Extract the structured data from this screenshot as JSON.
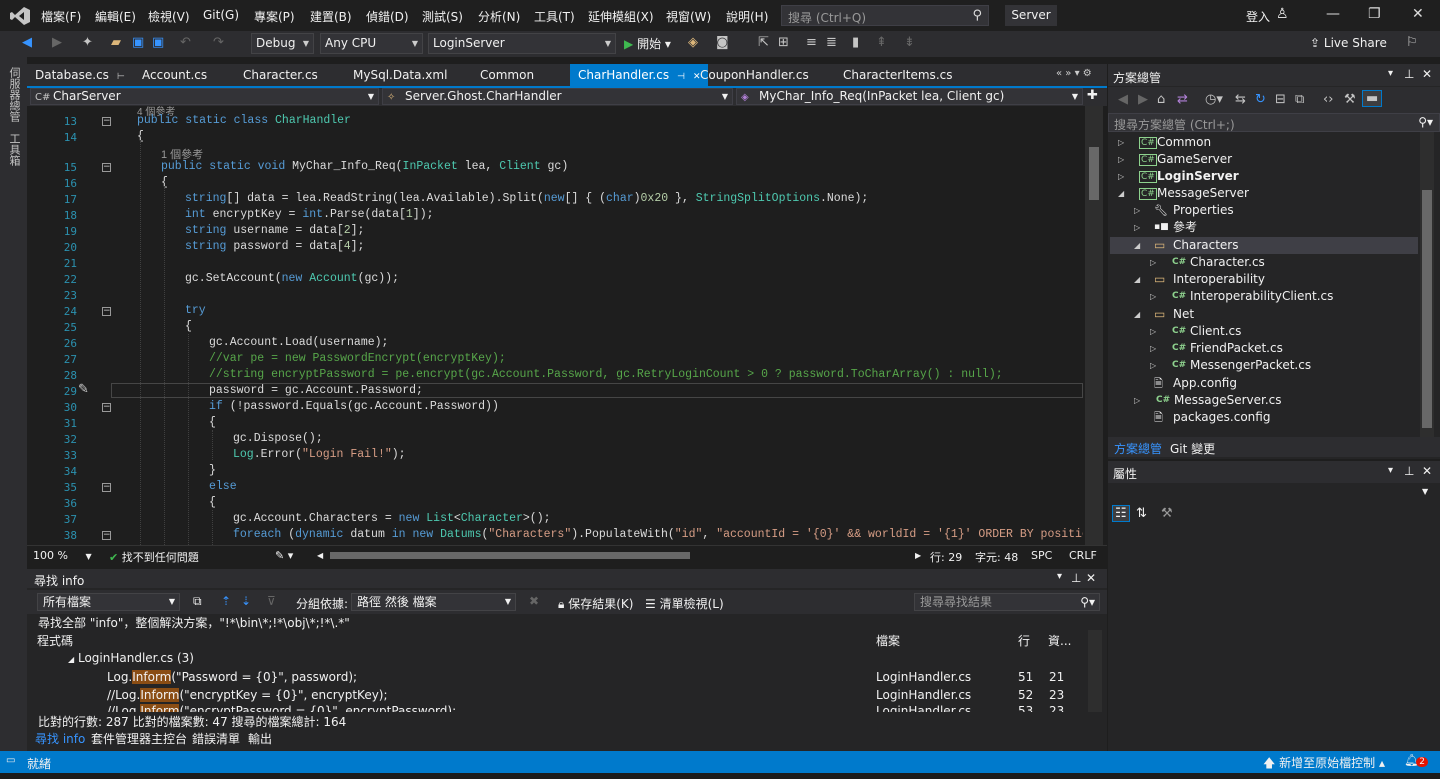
{
  "menu": [
    "檔案(F)",
    "編輯(E)",
    "檢視(V)",
    "Git(G)",
    "專案(P)",
    "建置(B)",
    "偵錯(D)",
    "測試(S)",
    "分析(N)",
    "工具(T)",
    "延伸模組(X)",
    "視窗(W)",
    "說明(H)"
  ],
  "search_placeholder": "搜尋 (Ctrl+Q)",
  "solution_name": "Server",
  "signin": "登入",
  "toolbar": {
    "config": "Debug",
    "platform": "Any CPU",
    "startup": "LoginServer",
    "start": "開始",
    "liveshare": "Live Share"
  },
  "left_tabs": [
    "伺服器總管",
    "工具箱"
  ],
  "tabs": [
    "Database.cs",
    "Account.cs",
    "Character.cs",
    "MySql.Data.xml",
    "Common",
    "CharHandler.cs",
    "CouponHandler.cs",
    "CharacterItems.cs"
  ],
  "active_tab": "CharHandler.cs",
  "nav": {
    "project": "CharServer",
    "type": "Server.Ghost.CharHandler",
    "member": "MyChar_Info_Req(InPacket lea, Client gc)"
  },
  "code": {
    "lens_top": "4 個參考",
    "line13": "public static class CharHandler",
    "line14": "{",
    "lens": "1 個參考",
    "line15": "public static void MyChar_Info_Req(InPacket lea, Client gc)",
    "line16": "{",
    "line17": "string[] data = lea.ReadString(lea.Available).Split(new[] { (char)0x20 }, StringSplitOptions.None);",
    "line18": "int encryptKey = int.Parse(data[1]);",
    "line19": "string username = data[2];",
    "line20": "string password = data[4];",
    "line21": "",
    "line22": "gc.SetAccount(new Account(gc));",
    "line23": "",
    "line24": "try",
    "line25": "{",
    "line26": "gc.Account.Load(username);",
    "line27": "//var pe = new PasswordEncrypt(encryptKey);",
    "line28": "//string encryptPassword = pe.encrypt(gc.Account.Password, gc.RetryLoginCount > 0 ? password.ToCharArray() : null);",
    "line29": "password = gc.Account.Password;",
    "line30": "if (!password.Equals(gc.Account.Password))",
    "line31": "{",
    "line32": "gc.Dispose();",
    "line33": "Log.Error(\"Login Fail!\");",
    "line34": "}",
    "line35": "else",
    "line36": "{",
    "line37": "gc.Account.Characters = new List<Character>();",
    "line38": "foreach (dynamic datum in new Datums(\"Characters\").PopulateWith(\"id\", \"accountId = '{0}' && worldId = '{1}' ORDER BY position ASC\", gc.Account"
  },
  "line_numbers": [
    "13",
    "14",
    "15",
    "16",
    "17",
    "18",
    "19",
    "20",
    "21",
    "22",
    "23",
    "24",
    "25",
    "26",
    "27",
    "28",
    "29",
    "30",
    "31",
    "32",
    "33",
    "34",
    "35",
    "36",
    "37",
    "38"
  ],
  "editor_status": {
    "zoom": "100 %",
    "issues": "找不到任何問題",
    "line": "行: 29",
    "col": "字元: 48",
    "spc": "SPC",
    "crlf": "CRLF"
  },
  "find": {
    "title": "尋找 info",
    "scope": "所有檔案",
    "group_label": "分組依據:",
    "group_value": "路徑 然後 檔案",
    "keep": "保存結果(K)",
    "list_view": "清單檢視(L)",
    "search_ph": "搜尋尋找結果",
    "summary_line": "尋找全部 \"info\"，整個解決方案，\"!*\\bin\\*;!*\\obj\\*;!*\\.*\"",
    "col_code": "程式碼",
    "col_file": "檔案",
    "col_line": "行",
    "col_col": "資...",
    "group": "LoginHandler.cs (3)",
    "results": [
      {
        "pre": "Log.",
        "hl": "Inform",
        "post": "(\"Password = {0}\", password);",
        "file": "LoginHandler.cs",
        "line": "51",
        "col": "21"
      },
      {
        "pre": "//Log.",
        "hl": "Inform",
        "post": "(\"encryptKey = {0}\", encryptKey);",
        "file": "LoginHandler.cs",
        "line": "52",
        "col": "23"
      },
      {
        "pre": "//Log.",
        "hl": "Inform",
        "post": "(\"encryptPassword = {0}\", encryptPassword);",
        "file": "LoginHandler.cs",
        "line": "53",
        "col": "23"
      }
    ],
    "stats": "比對的行數: 287 比對的檔案數: 47 搜尋的檔案總計: 164",
    "bottom_tabs": [
      "尋找 info",
      "套件管理器主控台",
      "錯誤清單",
      "輸出"
    ]
  },
  "solution_explorer": {
    "title": "方案總管",
    "search_ph": "搜尋方案總管 (Ctrl+;)",
    "items": [
      {
        "label": "Common",
        "kind": "proj"
      },
      {
        "label": "GameServer",
        "kind": "proj"
      },
      {
        "label": "LoginServer",
        "kind": "proj"
      },
      {
        "label": "MessageServer",
        "kind": "proj"
      },
      {
        "label": "Properties",
        "kind": "props"
      },
      {
        "label": "參考",
        "kind": "ref"
      },
      {
        "label": "Characters",
        "kind": "folder"
      },
      {
        "label": "Character.cs",
        "kind": "cs"
      },
      {
        "label": "Interoperability",
        "kind": "folder"
      },
      {
        "label": "InteroperabilityClient.cs",
        "kind": "cs"
      },
      {
        "label": "Net",
        "kind": "folder"
      },
      {
        "label": "Client.cs",
        "kind": "cs"
      },
      {
        "label": "FriendPacket.cs",
        "kind": "cs"
      },
      {
        "label": "MessengerPacket.cs",
        "kind": "cs"
      },
      {
        "label": "App.config",
        "kind": "config"
      },
      {
        "label": "MessageServer.cs",
        "kind": "cs"
      },
      {
        "label": "packages.config",
        "kind": "config"
      }
    ],
    "tabs": [
      "方案總管",
      "Git 變更"
    ]
  },
  "properties_title": "屬性",
  "status": {
    "ready": "就緒",
    "source_control": "新增至原始檔控制",
    "notif_count": "2"
  }
}
